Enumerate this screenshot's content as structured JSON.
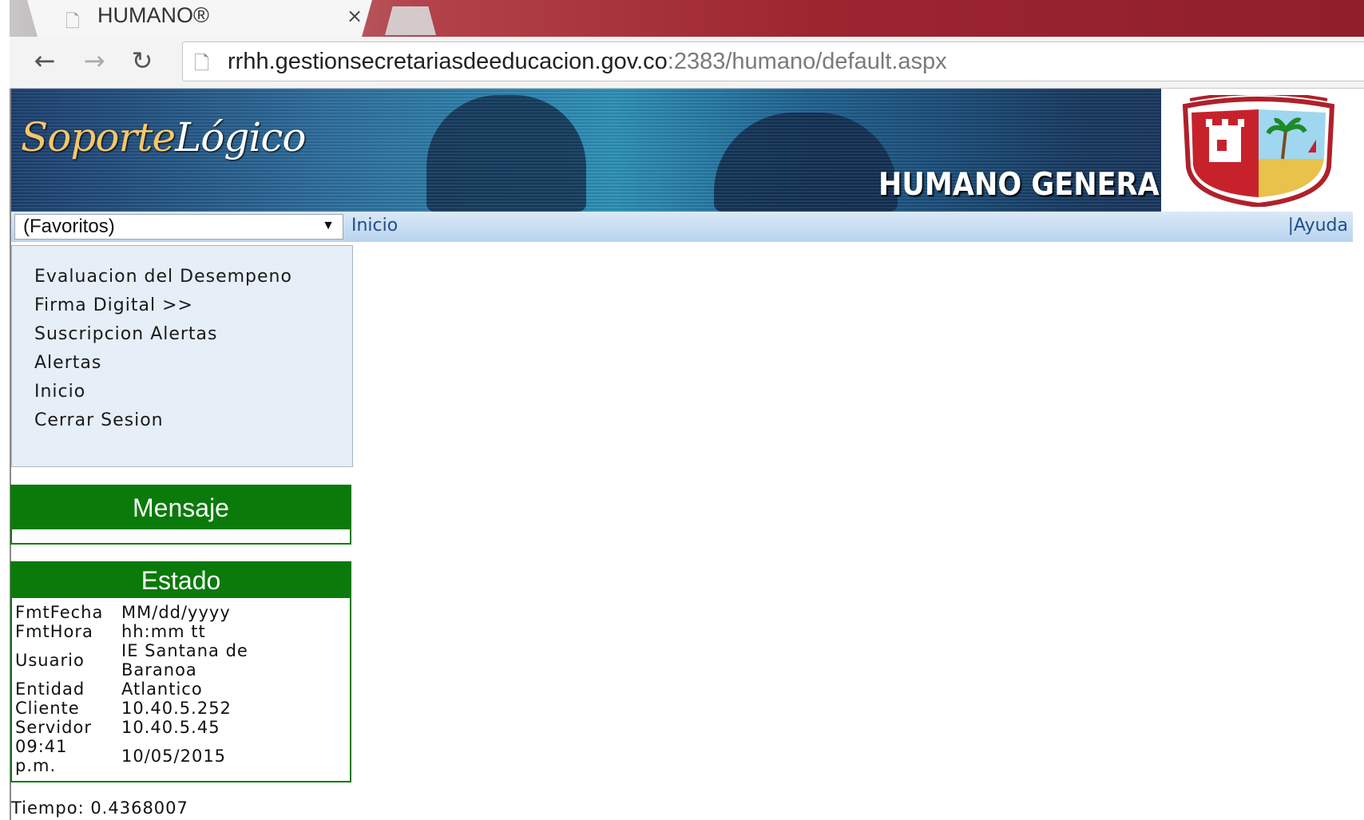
{
  "browser": {
    "tab_title": "HUMANO®",
    "tab_close": "×",
    "url_host": "rrhh.gestionsecretariasdeeducacion.gov.co",
    "url_rest": ":2383/humano/default.aspx"
  },
  "banner": {
    "logo_part1": "Soporte",
    "logo_part2": "Lógico",
    "title": "HUMANO GENERAL"
  },
  "navbar": {
    "favorites_value": "(Favoritos)",
    "inicio_label": "Inicio",
    "ayuda_label": "|Ayuda"
  },
  "menu": {
    "items": [
      "Evaluacion del Desempeno",
      "Firma Digital >>",
      "Suscripcion Alertas",
      "Alertas",
      "Inicio",
      "Cerrar Sesion"
    ]
  },
  "mensaje": {
    "title": "Mensaje"
  },
  "estado": {
    "title": "Estado",
    "rows": [
      {
        "key": "FmtFecha",
        "value": "MM/dd/yyyy"
      },
      {
        "key": "FmtHora",
        "value": "hh:mm tt"
      },
      {
        "key": "Usuario",
        "value": "IE Santana de Baranoa"
      },
      {
        "key": "Entidad",
        "value": "Atlantico"
      },
      {
        "key": "Cliente",
        "value": "10.40.5.252"
      },
      {
        "key": "Servidor",
        "value": "10.40.5.45"
      },
      {
        "key": "09:41 p.m.",
        "value": "10/05/2015"
      }
    ]
  },
  "footer": {
    "tiempo": "Tiempo: 0.4368007"
  },
  "colors": {
    "panel_green": "#0a7a0a",
    "link_blue": "#1f4e8c",
    "menu_bg": "#e6eef8"
  }
}
